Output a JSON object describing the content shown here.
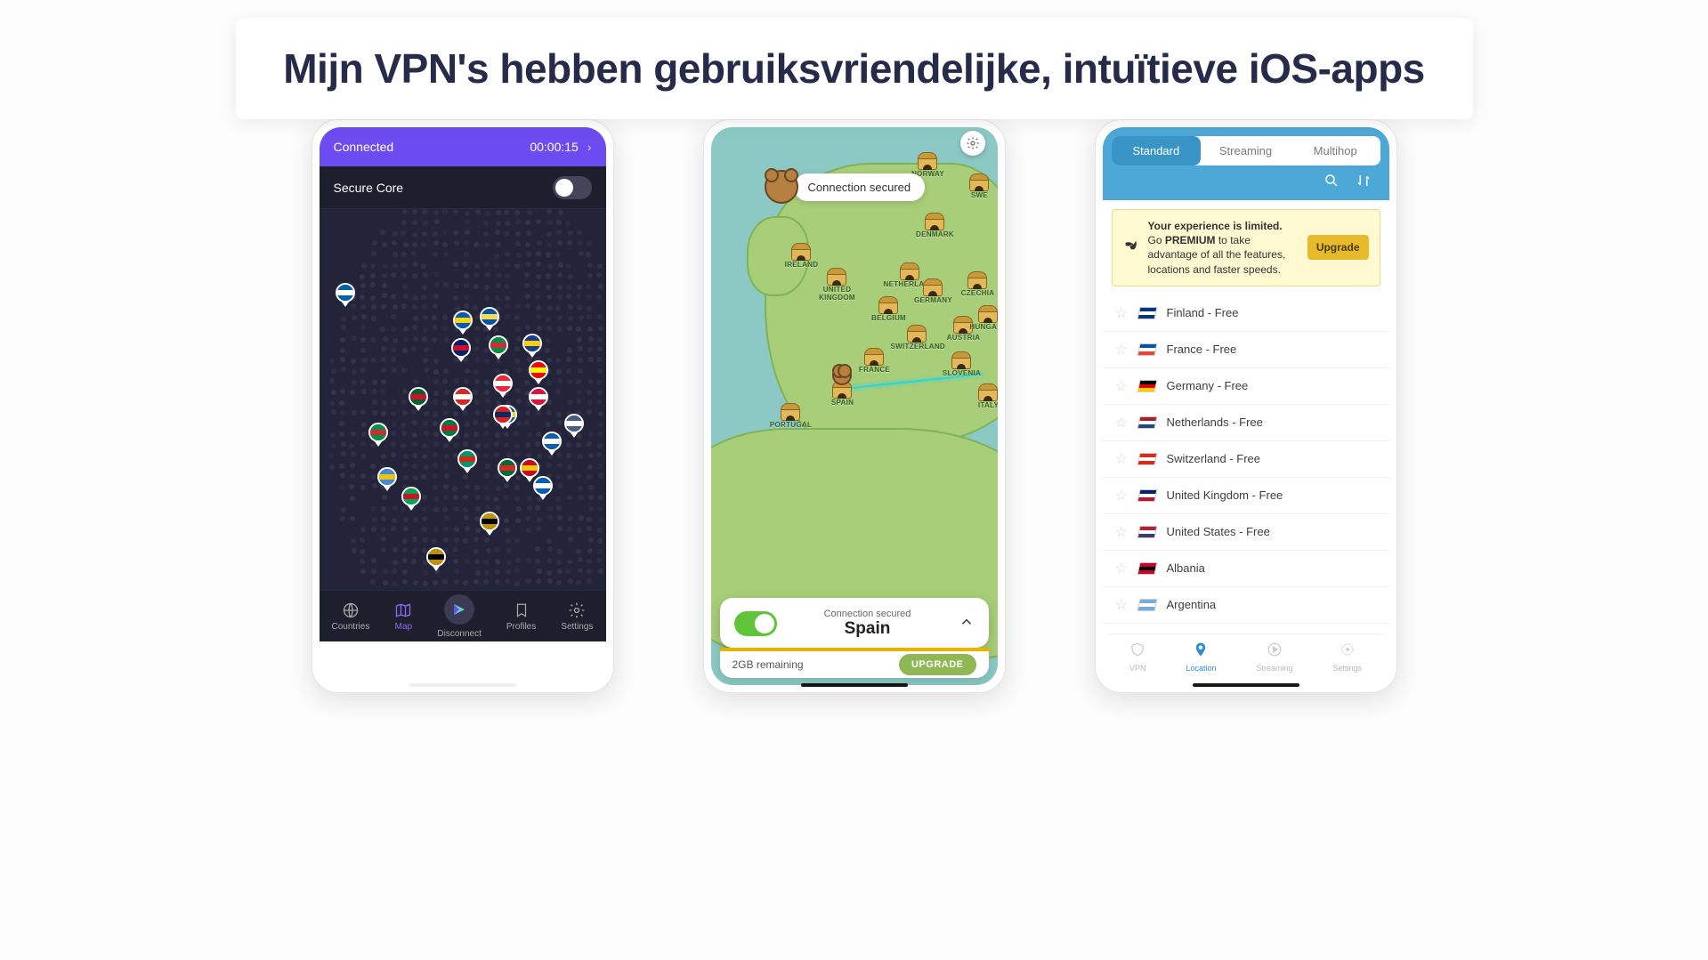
{
  "title": "Mijn VPN's hebben gebruiksvriendelijke, intuïtieve iOS-apps",
  "phone1": {
    "status_label": "Connected",
    "timer": "00:00:15",
    "secure_core": "Secure Core",
    "nav": {
      "countries": "Countries",
      "map": "Map",
      "disconnect": "Disconnect",
      "profiles": "Profiles",
      "settings": "Settings"
    }
  },
  "phone2": {
    "bubble": "Connection secured",
    "card_status": "Connection secured",
    "card_location": "Spain",
    "remaining": "2GB remaining",
    "upgrade": "UPGRADE",
    "labels": {
      "ireland": "IRELAND",
      "uk": "UNITED KINGDOM",
      "portugal": "PORTUGAL",
      "spain": "SPAIN",
      "france": "FRANCE",
      "belgium": "BELGIUM",
      "netherl": "NETHERLANDS",
      "germany": "GERMANY",
      "swiss": "SWITZERLAND",
      "czech": "CZECHIA",
      "austria": "AUSTRIA",
      "slovenia": "SLOVENIA",
      "italy": "ITALY",
      "norway": "NORWAY",
      "swe": "SWE",
      "den": "DENMARK",
      "hun": "HUNGARY"
    }
  },
  "phone3": {
    "tabs": {
      "standard": "Standard",
      "streaming": "Streaming",
      "multihop": "Multihop"
    },
    "promo_line1": "Your experience is limited.",
    "promo_line2": " Go ",
    "promo_bold": "PREMIUM",
    "promo_rest": " to take advantage of all the features, locations and faster speeds.",
    "promo_btn": "Upgrade",
    "countries": [
      "Finland - Free",
      "France - Free",
      "Germany - Free",
      "Netherlands - Free",
      "Switzerland - Free",
      "United Kingdom - Free",
      "United States - Free",
      "Albania",
      "Argentina"
    ],
    "nav": {
      "vpn": "VPN",
      "location": "Location",
      "streaming": "Streaming",
      "settings": "Settings"
    }
  }
}
